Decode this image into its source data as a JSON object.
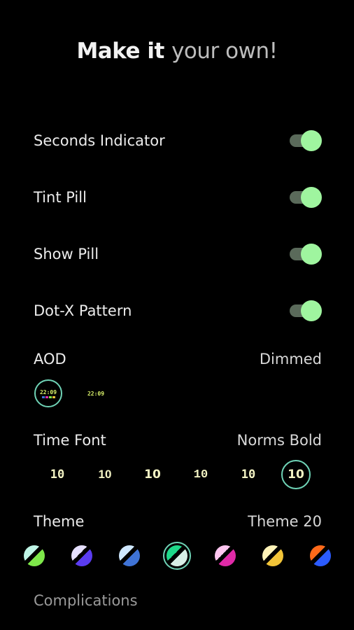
{
  "header": {
    "title_part1": "Make it",
    "title_part2": "your own!"
  },
  "toggles": [
    {
      "label": "Seconds Indicator",
      "on": true
    },
    {
      "label": "Tint Pill",
      "on": true
    },
    {
      "label": "Show Pill",
      "on": true
    },
    {
      "label": "Dot-X Pattern",
      "on": true
    }
  ],
  "aod": {
    "label": "AOD",
    "value": "Dimmed",
    "options": [
      {
        "time": "22:09",
        "selected": true
      },
      {
        "time": "22:09",
        "selected": false
      }
    ]
  },
  "time_font": {
    "label": "Time Font",
    "value": "Norms Bold",
    "options": [
      "10",
      "10",
      "10",
      "10",
      "10",
      "10"
    ],
    "selected_index": 5
  },
  "theme": {
    "label": "Theme",
    "value": "Theme 20",
    "swatches": [
      {
        "c1": "#bff5e6",
        "c2": "#7ee84a"
      },
      {
        "c1": "#e6e0ff",
        "c2": "#5a3cf0"
      },
      {
        "c1": "#cfe8ff",
        "c2": "#3f73d6"
      },
      {
        "c1": "#1ed98a",
        "c2": "#d7eee6"
      },
      {
        "c1": "#ffc6f0",
        "c2": "#e02aa8"
      },
      {
        "c1": "#fff3b8",
        "c2": "#f2c438"
      },
      {
        "c1": "#ff6a1a",
        "c2": "#2b5bff"
      }
    ],
    "selected_index": 3
  },
  "complications": {
    "label": "Complications"
  },
  "colors": {
    "accent": "#9ff59f",
    "selection_ring": "#6fd3b6",
    "background": "#000000"
  }
}
